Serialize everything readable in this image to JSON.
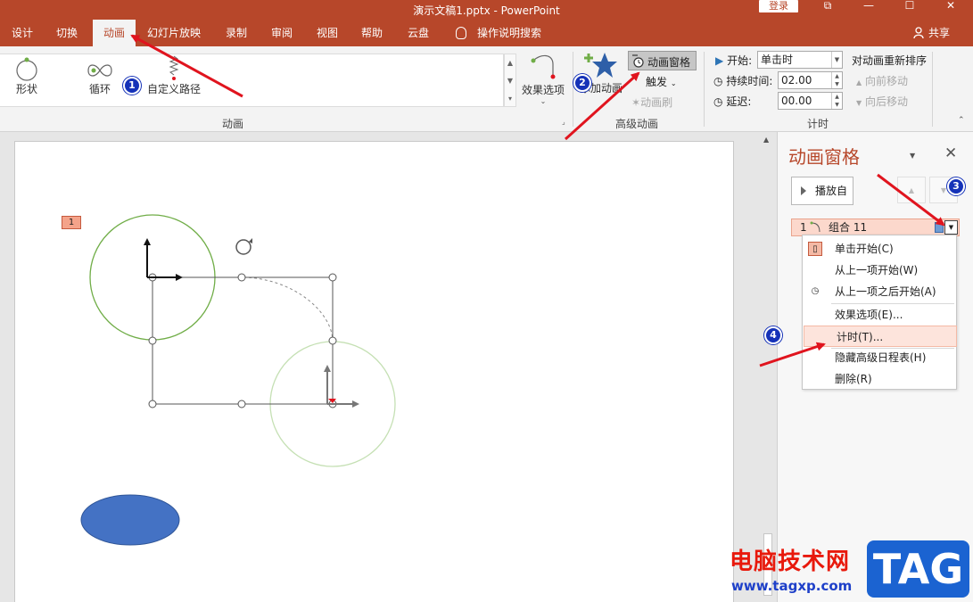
{
  "window": {
    "title": "演示文稿1.pptx - PowerPoint",
    "login_label": "登录",
    "controls": [
      "⧉",
      "—",
      "☐",
      "✕"
    ]
  },
  "tabs": [
    "设计",
    "切换",
    "动画",
    "幻灯片放映",
    "录制",
    "审阅",
    "视图",
    "帮助",
    "云盘",
    "操作说明搜索"
  ],
  "active_tab": "动画",
  "share_label": "共享",
  "ribbon": {
    "animation_group": {
      "label": "动画",
      "items": [
        "形状",
        "循环",
        "自定义路径"
      ],
      "effect_options": "效果选项"
    },
    "advanced_group": {
      "label": "高级动画",
      "add_animation": "添加动画",
      "animation_pane": "动画窗格",
      "trigger": "触发",
      "animation_painter": "动画刷"
    },
    "timing_group": {
      "label": "计时",
      "start_label": "开始:",
      "start_value": "单击时",
      "duration_label": "持续时间:",
      "duration_value": "02.00",
      "delay_label": "延迟:",
      "delay_value": "00.00",
      "reorder_title": "对动画重新排序",
      "move_earlier": "向前移动",
      "move_later": "向后移动"
    }
  },
  "slide": {
    "anim_tag": "1"
  },
  "pane": {
    "title": "动画窗格",
    "play_from": "播放自",
    "item": {
      "number": "1",
      "label": "组合 11"
    }
  },
  "context_menu": {
    "items": [
      {
        "label": "单击开始(C)",
        "icon": "mouse-icon"
      },
      {
        "label": "从上一项开始(W)",
        "icon": ""
      },
      {
        "label": "从上一项之后开始(A)",
        "icon": "clock-icon"
      },
      {
        "label": "效果选项(E)...",
        "icon": ""
      },
      {
        "label": "计时(T)...",
        "icon": ""
      },
      {
        "label": "隐藏高级日程表(H)",
        "icon": ""
      },
      {
        "label": "删除(R)",
        "icon": ""
      }
    ]
  },
  "markers": [
    "1",
    "2",
    "3",
    "4"
  ],
  "watermark": {
    "cn": "电脑技术网",
    "url": "www.tagxp.com",
    "tag": "TAG"
  },
  "colors": {
    "brand": "#b7472a",
    "marker": "#1532b8",
    "arrow": "#e0141e",
    "circle": "#70ad47",
    "ellipse": "#4472c4"
  }
}
